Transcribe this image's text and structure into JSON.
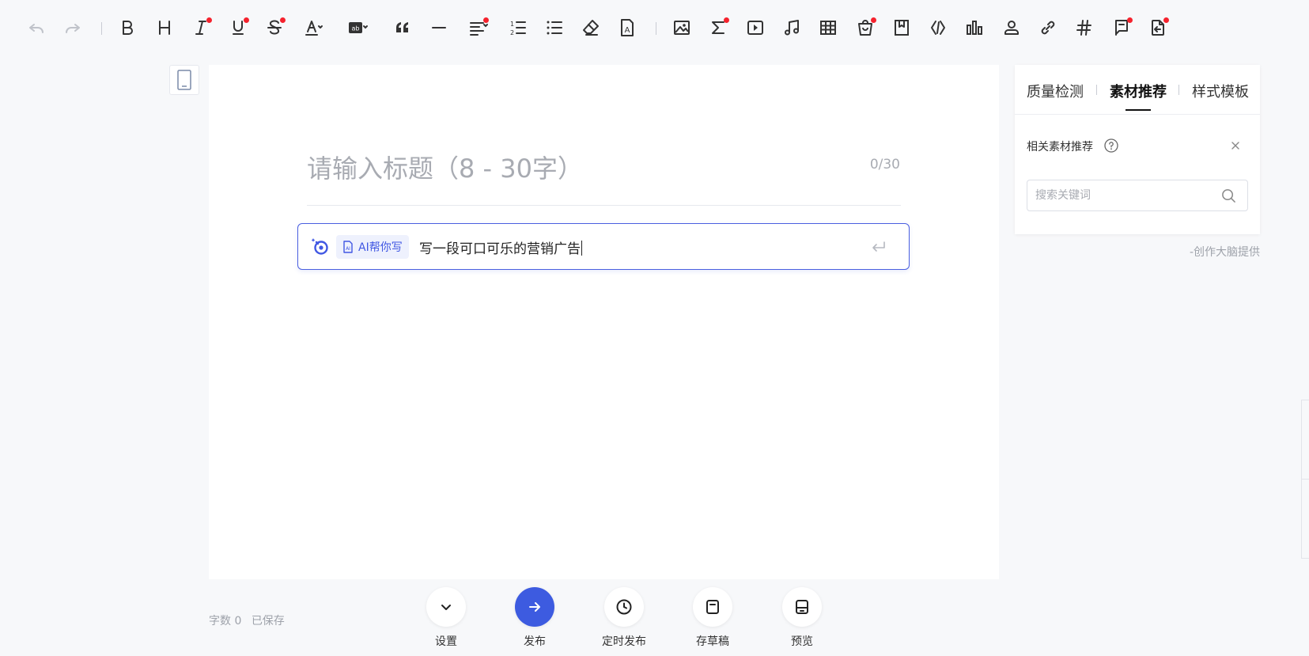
{
  "toolbar": {
    "items": [
      {
        "name": "undo-icon",
        "label": "undo",
        "dot": false
      },
      {
        "name": "redo-icon",
        "label": "redo",
        "dot": false
      },
      {
        "name": "bold-icon",
        "label": "B",
        "dot": false
      },
      {
        "name": "heading-icon",
        "label": "H",
        "dot": false
      },
      {
        "name": "italic-icon",
        "label": "I",
        "dot": true
      },
      {
        "name": "underline-icon",
        "label": "U",
        "dot": true
      },
      {
        "name": "strikethrough-icon",
        "label": "S",
        "dot": true
      },
      {
        "name": "font-color-icon",
        "label": "A",
        "dot": false
      },
      {
        "name": "background-color-icon",
        "label": "ab",
        "dot": false
      },
      {
        "name": "quote-icon",
        "label": "quote",
        "dot": false
      },
      {
        "name": "divider-icon",
        "label": "divider",
        "dot": false
      },
      {
        "name": "align-icon",
        "label": "align",
        "dot": true
      },
      {
        "name": "ordered-list-icon",
        "label": "ordered list",
        "dot": false
      },
      {
        "name": "bullet-list-icon",
        "label": "bullet list",
        "dot": false
      },
      {
        "name": "eraser-icon",
        "label": "clear format",
        "dot": false
      },
      {
        "name": "format-painter-icon",
        "label": "format",
        "dot": false
      },
      {
        "name": "image-icon",
        "label": "image",
        "dot": false
      },
      {
        "name": "formula-icon",
        "label": "formula",
        "dot": true
      },
      {
        "name": "video-icon",
        "label": "video",
        "dot": false
      },
      {
        "name": "music-icon",
        "label": "audio",
        "dot": false
      },
      {
        "name": "table-icon",
        "label": "table",
        "dot": false
      },
      {
        "name": "shopping-bag-icon",
        "label": "product",
        "dot": true
      },
      {
        "name": "bookmark-icon",
        "label": "bookmark",
        "dot": false
      },
      {
        "name": "code-icon",
        "label": "code",
        "dot": false
      },
      {
        "name": "bar-chart-icon",
        "label": "chart",
        "dot": false
      },
      {
        "name": "user-card-icon",
        "label": "user card",
        "dot": false
      },
      {
        "name": "link-icon",
        "label": "link",
        "dot": false
      },
      {
        "name": "hashtag-icon",
        "label": "topic",
        "dot": false
      },
      {
        "name": "flag-icon",
        "label": "flag",
        "dot": true
      },
      {
        "name": "export-icon",
        "label": "export",
        "dot": true
      }
    ]
  },
  "editor": {
    "title_placeholder": "请输入标题（8 - 30字）",
    "title_count": "0/30",
    "ai_chip_label": "AI帮你写",
    "ai_prompt_text": "写一段可口可乐的营销广告"
  },
  "panel": {
    "tabs": [
      "质量检测",
      "素材推荐",
      "样式模板"
    ],
    "active_tab": "素材推荐",
    "section_title": "相关素材推荐",
    "search_placeholder": "搜索关键词",
    "provider": "-创作大脑提供"
  },
  "status": {
    "word_count": "字数 0",
    "saved": "已保存"
  },
  "actions": {
    "settings": "设置",
    "publish": "发布",
    "scheduled_publish": "定时发布",
    "save_draft": "存草稿",
    "preview": "预览"
  },
  "colors": {
    "accent": "#3d5be0",
    "ai_border": "#4a5fe0",
    "badge_dot": "#f5222d",
    "background": "#f7f8fa"
  }
}
